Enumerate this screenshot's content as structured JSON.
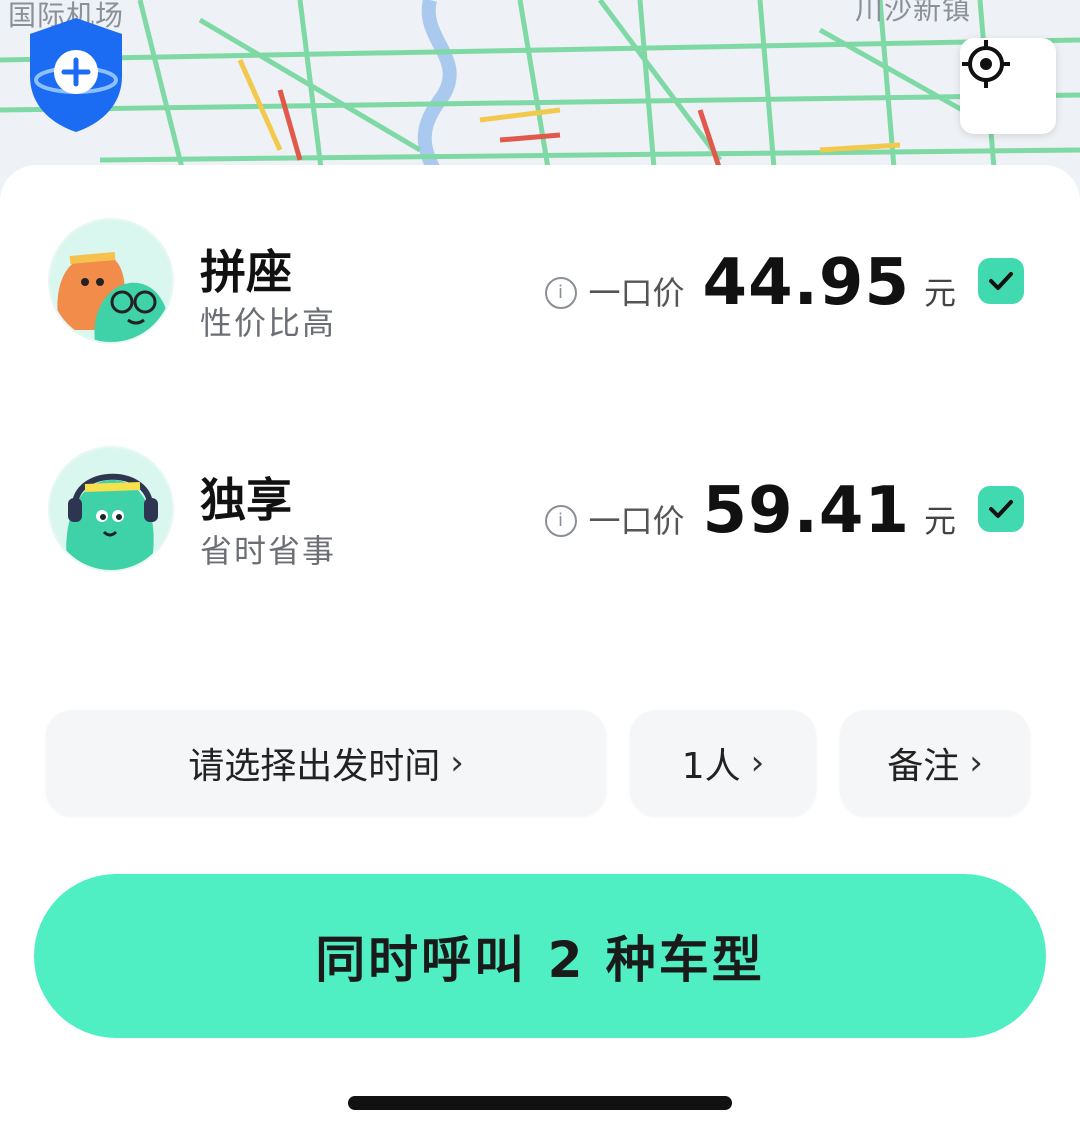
{
  "map": {
    "label_left": "国际机场",
    "label_right": "川沙新镇"
  },
  "colors": {
    "accent": "#4fefc3",
    "check": "#41d9b0",
    "traffic_green": "#7ed9a5",
    "traffic_yellow": "#f2c94c",
    "traffic_red": "#e0594b",
    "river": "#a9c9ef"
  },
  "icons": {
    "shield": "shield-plus-icon",
    "locate": "crosshair-icon",
    "info": "info-icon",
    "check": "check-icon",
    "chevron": "chevron-right-icon"
  },
  "rides": [
    {
      "title": "拼座",
      "subtitle": "性价比高",
      "price_label": "一口价",
      "price": "44.95",
      "unit": "元",
      "checked": true
    },
    {
      "title": "独享",
      "subtitle": "省时省事",
      "price_label": "一口价",
      "price": "59.41",
      "unit": "元",
      "checked": true
    }
  ],
  "options": {
    "departure_time": "请选择出发时间",
    "passengers": "1人",
    "note": "备注",
    "chevron": "›"
  },
  "cta": {
    "label": "同时呼叫 2 种车型"
  }
}
